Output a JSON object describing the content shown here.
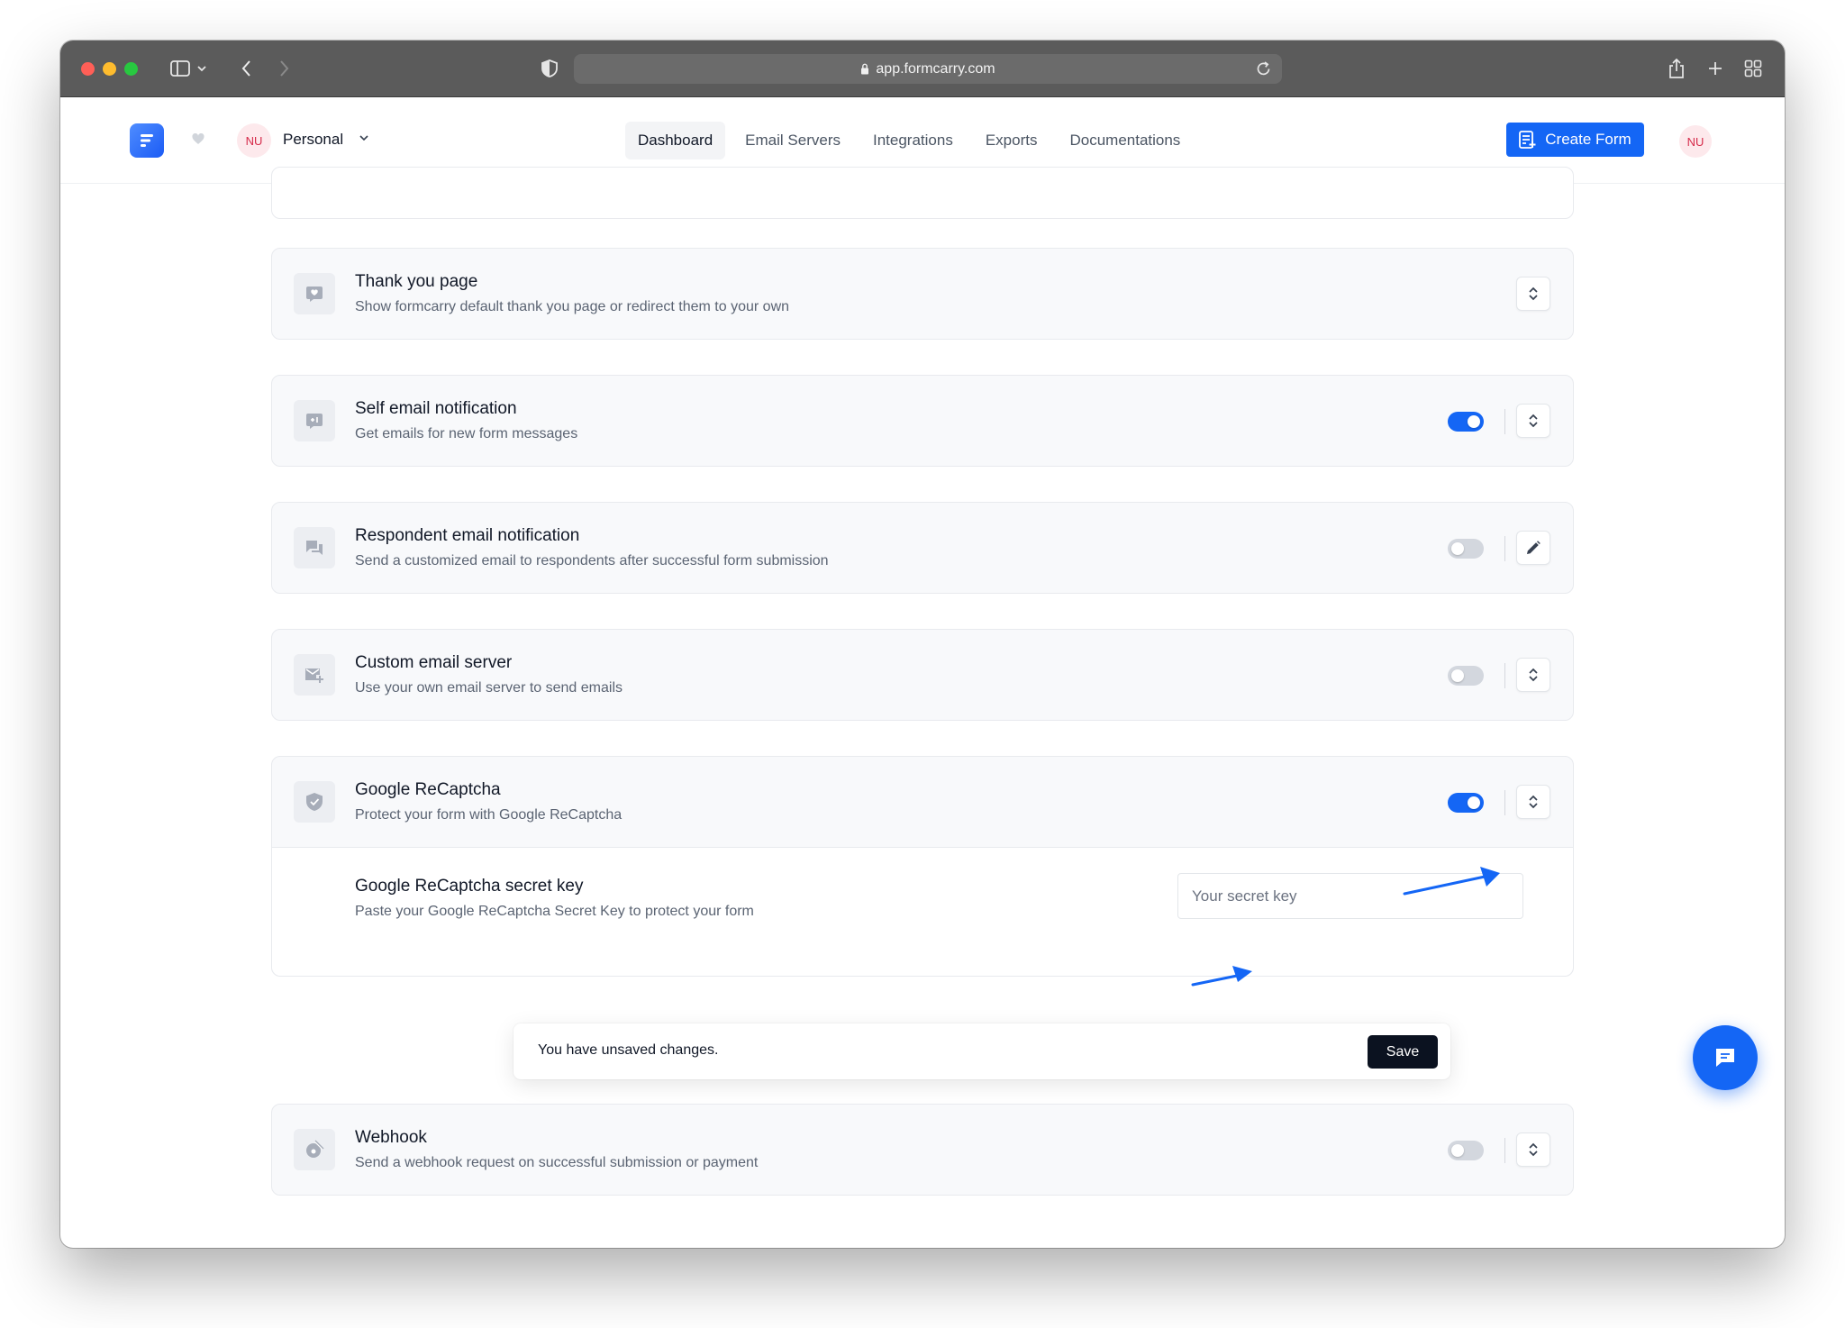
{
  "browser": {
    "url": "app.formcarry.com"
  },
  "header": {
    "workspace_initials": "NU",
    "workspace_name": "Personal",
    "nav": [
      {
        "label": "Dashboard",
        "active": true
      },
      {
        "label": "Email Servers",
        "active": false
      },
      {
        "label": "Integrations",
        "active": false
      },
      {
        "label": "Exports",
        "active": false
      },
      {
        "label": "Documentations",
        "active": false
      }
    ],
    "create_label": "Create Form",
    "user_initials": "NU"
  },
  "settings": [
    {
      "title": "Thank you page",
      "subtitle": "Show formcarry default thank you page or redirect them to your own",
      "icon": "thank-you-icon",
      "toggle": null,
      "action": "expand"
    },
    {
      "title": "Self email notification",
      "subtitle": "Get emails for new form messages",
      "icon": "self-email-icon",
      "toggle": true,
      "action": "expand"
    },
    {
      "title": "Respondent email notification",
      "subtitle": "Send a customized email to respondents after successful form submission",
      "icon": "respondent-email-icon",
      "toggle": false,
      "action": "edit"
    },
    {
      "title": "Custom email server",
      "subtitle": "Use your own email server to send emails",
      "icon": "custom-email-server-icon",
      "toggle": false,
      "action": "expand"
    },
    {
      "title": "Google ReCaptcha",
      "subtitle": "Protect your form with Google ReCaptcha",
      "icon": "shield-icon",
      "toggle": true,
      "action": "expand"
    },
    {
      "title": "Webhook",
      "subtitle": "Send a webhook request on successful submission or payment",
      "icon": "webhook-icon",
      "toggle": false,
      "action": "expand"
    }
  ],
  "recaptcha": {
    "key_title": "Google ReCaptcha secret key",
    "key_subtitle": "Paste your Google ReCaptcha Secret Key to protect your form",
    "key_value": "",
    "key_placeholder": "Your secret key"
  },
  "save_bar": {
    "message": "You have unsaved changes.",
    "save_label": "Save"
  },
  "colors": {
    "accent": "#1466f5",
    "toggle_off": "#d3d7de",
    "save_button": "#0b1220",
    "annotation_arrow": "#1466f5"
  }
}
